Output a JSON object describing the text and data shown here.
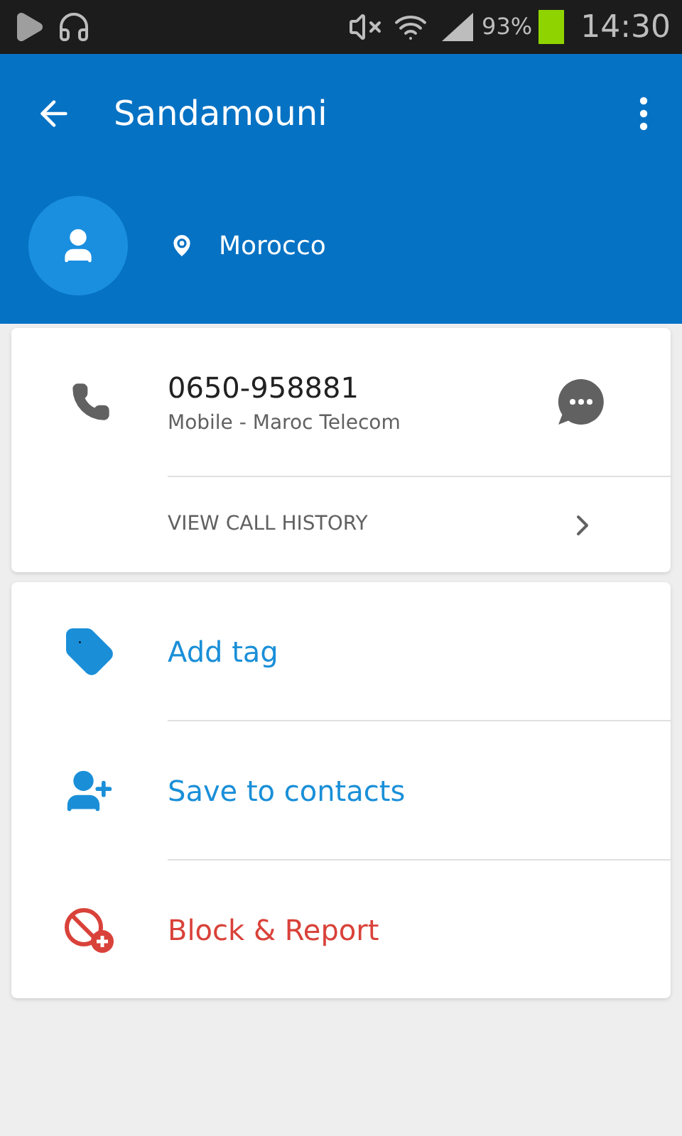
{
  "status_bar": {
    "battery": "93%",
    "time": "14:30"
  },
  "toolbar": {
    "title": "Sandamouni"
  },
  "profile": {
    "location": "Morocco"
  },
  "phone": {
    "number": "0650-958881",
    "type": "Mobile - Maroc Telecom",
    "history_link": "VIEW CALL HISTORY"
  },
  "actions": [
    {
      "kind": "tag",
      "label": "Add tag",
      "color": "#1a8fd8"
    },
    {
      "kind": "add-contact",
      "label": "Save to contacts",
      "color": "#1a8fd8"
    },
    {
      "kind": "block",
      "label": "Block & Report",
      "color": "#d9423a"
    }
  ]
}
